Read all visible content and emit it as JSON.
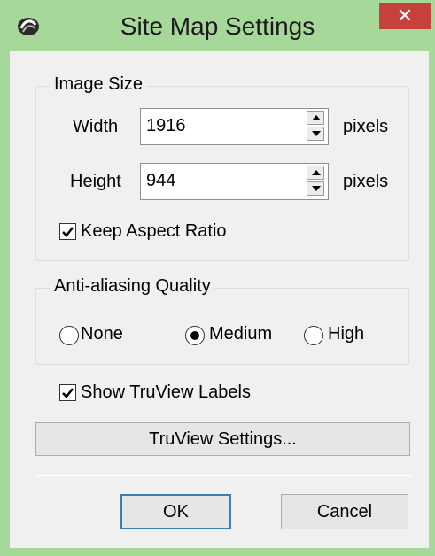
{
  "window": {
    "title": "Site Map Settings",
    "close_glyph": "✕",
    "accent": "#a6d89a",
    "close_color": "#c7413a"
  },
  "image_size": {
    "label": "Image Size",
    "width_label": "Width",
    "width_value": "1916",
    "height_label": "Height",
    "height_value": "944",
    "unit": "pixels",
    "keep_aspect_label": "Keep Aspect Ratio",
    "keep_aspect_checked": true
  },
  "antialias": {
    "label": "Anti-aliasing Quality",
    "options": [
      {
        "label": "None",
        "selected": false
      },
      {
        "label": "Medium",
        "selected": true
      },
      {
        "label": "High",
        "selected": false
      }
    ]
  },
  "show_truview_labels": {
    "label": "Show TruView Labels",
    "checked": true
  },
  "buttons": {
    "truview_settings": "TruView Settings...",
    "ok": "OK",
    "cancel": "Cancel"
  },
  "icons": {
    "app": "app-logo-icon",
    "close": "close-icon"
  }
}
